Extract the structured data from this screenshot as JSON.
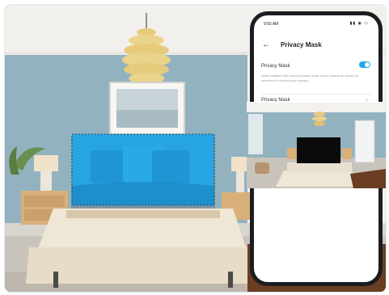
{
  "app": {
    "status_time": "9:55 AM",
    "status_icons": "▮▮ ◉ ▭",
    "back_icon": "arrow-left-icon",
    "title": "Privacy Mask",
    "rows": [
      {
        "label": "Privacy Mask",
        "toggle": "on"
      },
      {
        "label": "Privacy Mask"
      }
    ],
    "description": "When enabled, the current privacy mask zones cannot be viewed or monitored to protect your privacy.",
    "chevron": "›"
  },
  "colors": {
    "wall": "#93b2c0",
    "mask_blue": "#27a4e2",
    "toggle_on": "#23a5e6",
    "camera_mask_black": "#0b0b0b"
  }
}
